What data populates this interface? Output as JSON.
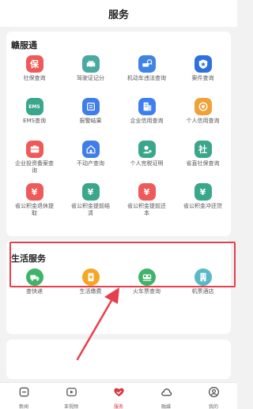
{
  "header": {
    "title": "服务"
  },
  "sections": [
    {
      "title": "赣服通",
      "items": [
        {
          "label": "社保查询",
          "icon": "shield-icon",
          "color": "#ee5a5a",
          "glyph": "保"
        },
        {
          "label": "驾驶证记分",
          "icon": "car-icon",
          "color": "#4aa9a0",
          "glyph": ""
        },
        {
          "label": "机动车违法查询",
          "icon": "car-search-icon",
          "color": "#3f83e4",
          "glyph": ""
        },
        {
          "label": "案件查询",
          "icon": "badge-star-icon",
          "color": "#2f6fe0",
          "glyph": ""
        },
        {
          "label": "EMS查询",
          "icon": "ems-icon",
          "color": "#3aa68b",
          "glyph": "EMS"
        },
        {
          "label": "报警结果",
          "icon": "alarm-icon",
          "color": "#3f7de8",
          "glyph": ""
        },
        {
          "label": "企业信用查询",
          "icon": "enterprise-icon",
          "color": "#3d7ff0",
          "glyph": ""
        },
        {
          "label": "个人信用查询",
          "icon": "credit-icon",
          "color": "#f0a137",
          "glyph": ""
        },
        {
          "label": "企业投资备案查询",
          "icon": "investment-icon",
          "color": "#ee5a5a",
          "glyph": ""
        },
        {
          "label": "不动产查询",
          "icon": "house-icon",
          "color": "#3f7de8",
          "glyph": ""
        },
        {
          "label": "个人完税证明",
          "icon": "tax-icon",
          "color": "#3aa68b",
          "glyph": ""
        },
        {
          "label": "省直社保查询",
          "icon": "social-security-icon",
          "color": "#3aa68b",
          "glyph": "社"
        },
        {
          "label": "省公积金退休提取",
          "icon": "fund-icon",
          "color": "#ee5a5a",
          "glyph": "¥"
        },
        {
          "label": "省公积金提前结清",
          "icon": "fund-icon",
          "color": "#3aa68b",
          "glyph": "¥"
        },
        {
          "label": "省公积金提前还本",
          "icon": "fund-icon",
          "color": "#ee5a5a",
          "glyph": "¥"
        },
        {
          "label": "省公积金冲还贷",
          "icon": "fund-icon",
          "color": "#3aa68b",
          "glyph": "¥"
        }
      ]
    },
    {
      "title": "生活服务",
      "items": [
        {
          "label": "查快递",
          "icon": "delivery-icon",
          "color": "#3fb36a",
          "glyph": ""
        },
        {
          "label": "生活缴费",
          "icon": "bill-icon",
          "color": "#f5a623",
          "glyph": ""
        },
        {
          "label": "火车票查询",
          "icon": "train-icon",
          "color": "#3fb36a",
          "glyph": ""
        },
        {
          "label": "机票酒店",
          "icon": "hotel-icon",
          "color": "#5ab9c9",
          "glyph": ""
        }
      ]
    }
  ],
  "tabs": [
    {
      "label": "新闻",
      "icon": "news-icon"
    },
    {
      "label": "亚视频",
      "icon": "video-icon"
    },
    {
      "label": "服务",
      "icon": "heart-hands-icon",
      "active": true
    },
    {
      "label": "融媒",
      "icon": "cloud-icon"
    },
    {
      "label": "我的",
      "icon": "profile-icon"
    }
  ],
  "colors": {
    "accent": "#d9363e",
    "highlight": "#e6404c"
  }
}
